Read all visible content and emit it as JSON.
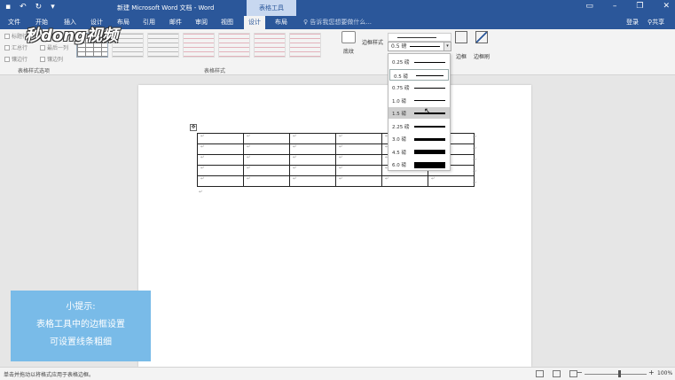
{
  "window": {
    "title": "新建 Microsoft Word 文档 - Word",
    "context_tab_group": "表格工具"
  },
  "tabs": [
    {
      "label": "文件"
    },
    {
      "label": "开始"
    },
    {
      "label": "插入"
    },
    {
      "label": "设计"
    },
    {
      "label": "布局"
    },
    {
      "label": "引用"
    },
    {
      "label": "邮件"
    },
    {
      "label": "审阅"
    },
    {
      "label": "视图"
    },
    {
      "label": "设计"
    },
    {
      "label": "布局"
    }
  ],
  "tell_me": "告诉我您想要做什么...",
  "account": {
    "login": "登录",
    "share": "共享"
  },
  "ribbon": {
    "style_options": {
      "items": [
        "标题行",
        "第一列",
        "汇总行",
        "最后一列",
        "镶边行",
        "镶边列"
      ],
      "group_label": "表格样式选项"
    },
    "table_styles_label": "表格样式",
    "shading_label": "底纹",
    "border_styles_label": "边框样式",
    "borders_label": "边框",
    "border_painter_label": "边框刷",
    "weight_value": "0.5 磅"
  },
  "weight_options": [
    {
      "label": "0.25 磅",
      "weight_pt": 0.25
    },
    {
      "label": "0.5 磅",
      "weight_pt": 0.5
    },
    {
      "label": "0.75 磅",
      "weight_pt": 0.75
    },
    {
      "label": "1.0 磅",
      "weight_pt": 1.0
    },
    {
      "label": "1.5 磅",
      "weight_pt": 1.5
    },
    {
      "label": "2.25 磅",
      "weight_pt": 2.25
    },
    {
      "label": "3.0 磅",
      "weight_pt": 3.0
    },
    {
      "label": "4.5 磅",
      "weight_pt": 4.5
    },
    {
      "label": "6.0 磅",
      "weight_pt": 6.0
    }
  ],
  "selected_weight": "0.5 磅",
  "hover_weight": "1.5 磅",
  "hint": {
    "title": "小提示:",
    "line1": "表格工具中的边框设置",
    "line2": "可设置线条粗细"
  },
  "statusbar": {
    "message": "单击并拖动以将格式应用于表格边框。",
    "zoom": "100%"
  },
  "logo_text": "秒懂视频",
  "table": {
    "rows": 5,
    "cols": 6
  }
}
